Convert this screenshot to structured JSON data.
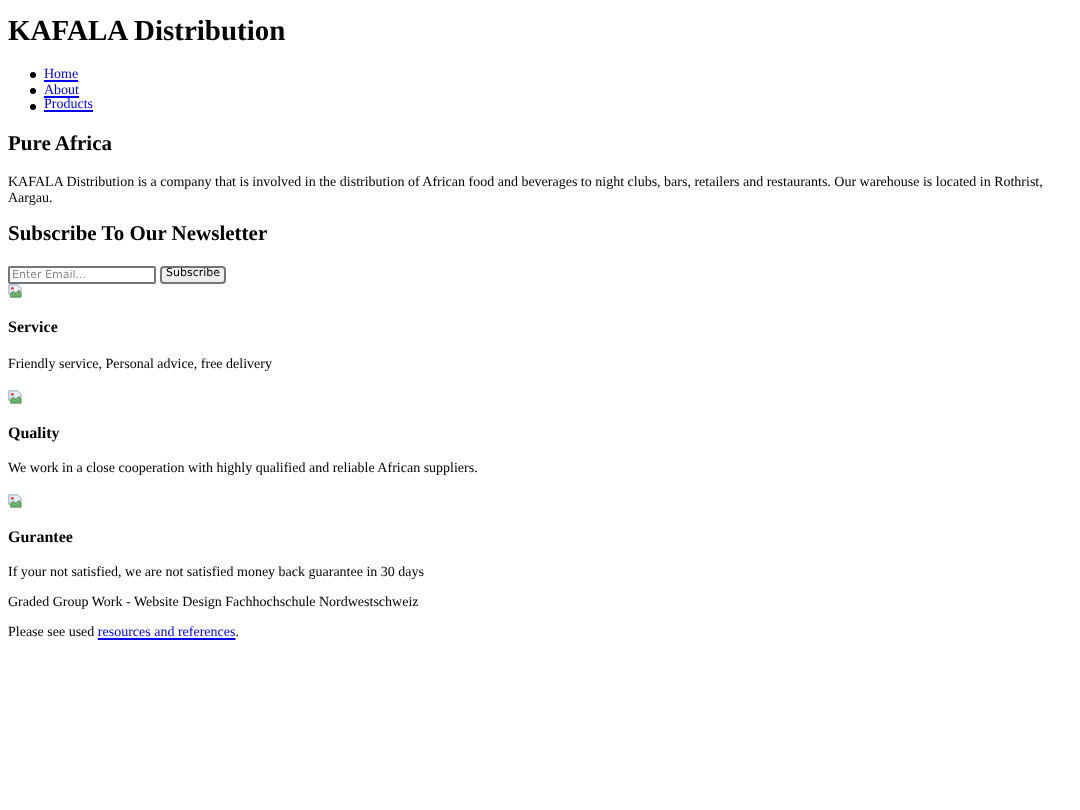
{
  "title": "KAFALA Distribution",
  "nav": [
    {
      "label": "Home"
    },
    {
      "label": "About"
    },
    {
      "label": "Products"
    }
  ],
  "intro": {
    "heading": "Pure Africa",
    "text": "KAFALA Distribution is a company that is involved in the distribution of African food and beverages to night clubs, bars, retailers and restaurants. Our warehouse is located in Rothrist, Aargau."
  },
  "newsletter": {
    "heading": "Subscribe To Our Newsletter",
    "placeholder": "Enter Email...",
    "button": "Subscribe"
  },
  "features": [
    {
      "heading": "Service",
      "text": "Friendly service, Personal advice, free delivery"
    },
    {
      "heading": "Quality",
      "text": "We work in a close cooperation with highly qualified and reliable African suppliers."
    },
    {
      "heading": "Gurantee",
      "text": "If your not satisfied, we are not satisfied money back guarantee in 30 days"
    }
  ],
  "footer": {
    "credit": "Graded Group Work - Website Design Fachhochschule Nordwestschweiz",
    "note_before": "Please see used ",
    "note_link": "resources and references",
    "note_after": "."
  }
}
